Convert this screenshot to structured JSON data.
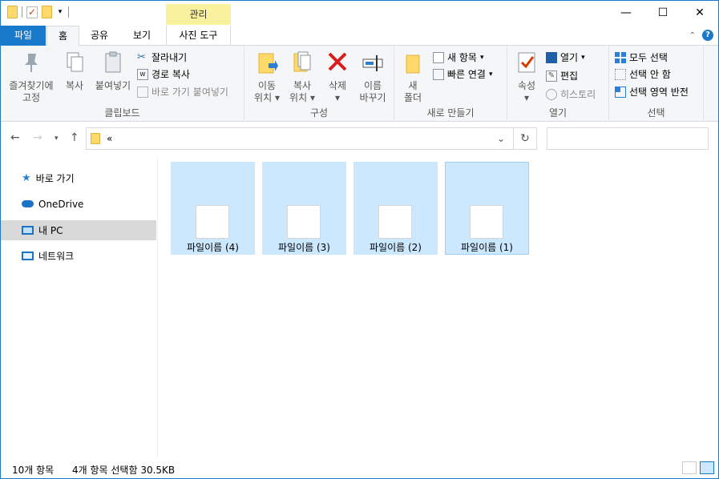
{
  "titlebar": {
    "contextual_tab": "관리",
    "contextual_subtab": "사진 도구",
    "minimize": "—",
    "maximize": "☐",
    "close": "✕"
  },
  "tabs": [
    "파일",
    "홈",
    "공유",
    "보기"
  ],
  "ribbon": {
    "clipboard": {
      "pin_label_1": "즐겨찾기에",
      "pin_label_2": "고정",
      "copy_label": "복사",
      "paste_label": "붙여넣기",
      "cut_label": "잘라내기",
      "copy_path_label": "경로 복사",
      "paste_shortcut_label": "바로 가기 붙여넣기",
      "group_label": "클립보드"
    },
    "organize": {
      "move_label_1": "이동",
      "move_label_2": "위치",
      "copyto_label_1": "복사",
      "copyto_label_2": "위치",
      "delete_label": "삭제",
      "rename_label_1": "이름",
      "rename_label_2": "바꾸기",
      "group_label": "구성"
    },
    "new": {
      "new_folder_label_1": "새",
      "new_folder_label_2": "폴더",
      "new_item_label": "새 항목",
      "easy_access_label": "빠른 연결",
      "group_label": "새로 만들기"
    },
    "open": {
      "properties_label": "속성",
      "open_label": "열기",
      "edit_label": "편집",
      "history_label": "히스토리",
      "group_label": "열기"
    },
    "select": {
      "select_all_label": "모두 선택",
      "select_none_label": "선택 안 함",
      "invert_label": "선택 영역 반전",
      "group_label": "선택"
    }
  },
  "address": {
    "path": "«",
    "dropdown": "⌄",
    "refresh": "↻"
  },
  "navpane": {
    "items": [
      "바로 가기",
      "OneDrive",
      "내 PC",
      "네트워크"
    ]
  },
  "files": [
    "파일이름 (4)",
    "파일이름 (3)",
    "파일이름 (2)",
    "파일이름 (1)"
  ],
  "status": {
    "count": "10개 항목",
    "selection": "4개 항목 선택함 30.5KB"
  },
  "colors": {
    "accent": "#1979ca",
    "selection": "#cce8ff",
    "contextual": "#f9f19e"
  }
}
